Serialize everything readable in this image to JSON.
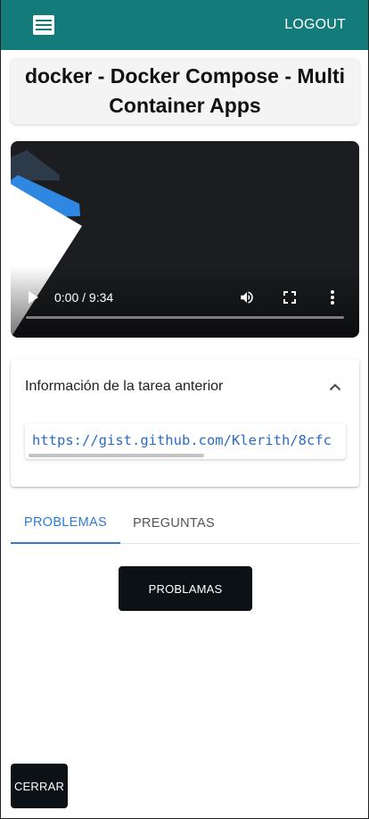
{
  "appbar": {
    "menu_icon": "hamburger-menu-icon",
    "logout_label": "LOGOUT",
    "color": "#147b7b"
  },
  "page": {
    "title": "docker - Docker Compose - Multi Container Apps"
  },
  "video": {
    "time": "0:00 / 9:34",
    "progress": 0,
    "icons": [
      "play-icon",
      "volume-icon",
      "fullscreen-icon",
      "more-options-icon"
    ]
  },
  "accordion": {
    "title": "Información de la tarea anterior",
    "expand_icon": "chevron-up-icon",
    "link_text": "https://gist.github.com/Klerith/8cfc"
  },
  "tabs": [
    {
      "label": "PROBLEMAS",
      "active": true
    },
    {
      "label": "PREGUNTAS",
      "active": false
    }
  ],
  "actions": {
    "problemas_label": "PROBLAMAS",
    "cerrar_label": "CERRAR"
  },
  "colors": {
    "accent": "#2e7bcf",
    "button_dark": "#0c1115"
  }
}
